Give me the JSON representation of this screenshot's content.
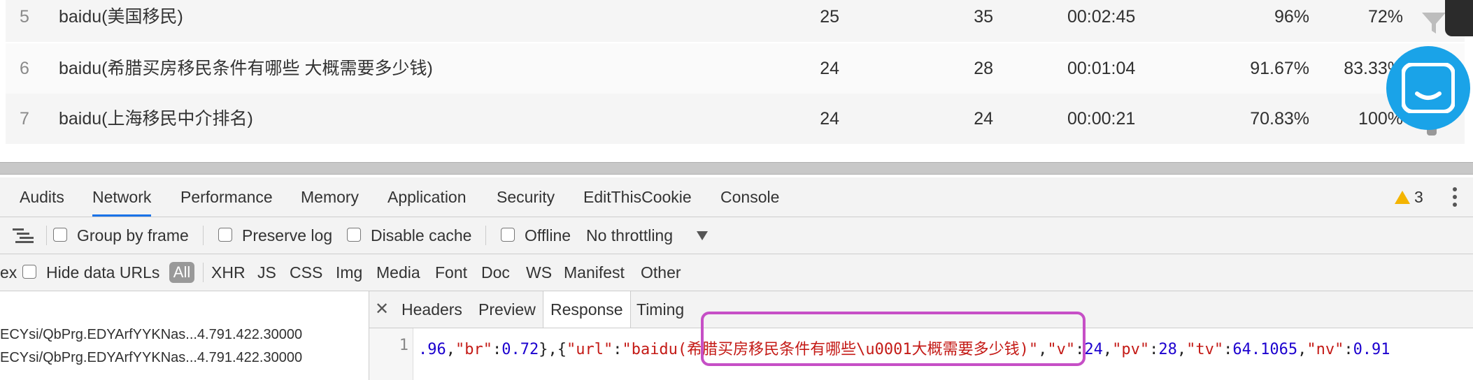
{
  "table": {
    "rows": [
      {
        "index": "5",
        "keyword": "baidu(美国移民)",
        "c1": "25",
        "c2": "35",
        "c3": "00:02:45",
        "c4": "96%",
        "c5": "72%"
      },
      {
        "index": "6",
        "keyword": "baidu(希腊买房移民条件有哪些 大概需要多少钱)",
        "c1": "24",
        "c2": "28",
        "c3": "00:01:04",
        "c4": "91.67%",
        "c5": "83.33%"
      },
      {
        "index": "7",
        "keyword": "baidu(上海移民中介排名)",
        "c1": "24",
        "c2": "24",
        "c3": "00:00:21",
        "c4": "70.83%",
        "c5": "100%"
      }
    ]
  },
  "devtools": {
    "tabs": [
      "Audits",
      "Network",
      "Performance",
      "Memory",
      "Application",
      "Security",
      "EditThisCookie",
      "Console"
    ],
    "active_tab": "Network",
    "warning_count": "3",
    "toolbar": {
      "group_by_frame": "Group by frame",
      "preserve_log": "Preserve log",
      "disable_cache": "Disable cache",
      "offline": "Offline",
      "throttling": "No throttling"
    },
    "filterbar": {
      "left_stub": "ex",
      "hide_data_urls": "Hide data URLs",
      "types": [
        "All",
        "XHR",
        "JS",
        "CSS",
        "Img",
        "Media",
        "Font",
        "Doc",
        "WS",
        "Manifest",
        "Other"
      ]
    },
    "requests": [
      "ECYsi/QbPrg.EDYArfYYKNas...4.791.422.30000",
      "ECYsi/QbPrg.EDYArfYYKNas...4.791.422.30000"
    ],
    "response_tabs": [
      "Headers",
      "Preview",
      "Response",
      "Timing"
    ],
    "response_active": "Response",
    "code": {
      "line_number": "1",
      "tokens": [
        {
          "t": ".96",
          "c": "n"
        },
        {
          "t": ",",
          "c": "p"
        },
        {
          "t": "\"br\"",
          "c": "k"
        },
        {
          "t": ":",
          "c": "p"
        },
        {
          "t": "0.72",
          "c": "n"
        },
        {
          "t": "},{",
          "c": "p"
        },
        {
          "t": "\"url\"",
          "c": "k"
        },
        {
          "t": ":",
          "c": "p"
        },
        {
          "t": "\"baidu(希腊买房移民条件有哪些\\u0001大概需要多少钱)\"",
          "c": "k"
        },
        {
          "t": ",",
          "c": "p"
        },
        {
          "t": "\"v\"",
          "c": "k"
        },
        {
          "t": ":",
          "c": "p"
        },
        {
          "t": "24",
          "c": "n"
        },
        {
          "t": ",",
          "c": "p"
        },
        {
          "t": "\"pv\"",
          "c": "k"
        },
        {
          "t": ":",
          "c": "p"
        },
        {
          "t": "28",
          "c": "n"
        },
        {
          "t": ",",
          "c": "p"
        },
        {
          "t": "\"tv\"",
          "c": "k"
        },
        {
          "t": ":",
          "c": "p"
        },
        {
          "t": "64.1065",
          "c": "n"
        },
        {
          "t": ",",
          "c": "p"
        },
        {
          "t": "\"nv\"",
          "c": "k"
        },
        {
          "t": ":",
          "c": "p"
        },
        {
          "t": "0.91",
          "c": "n"
        }
      ]
    }
  },
  "colors": {
    "accent": "#1a73e8",
    "chat_button": "#1aa3e8",
    "highlight_box": "#c64fc6",
    "json_string": "#c41a16",
    "json_number": "#1c00cf"
  }
}
